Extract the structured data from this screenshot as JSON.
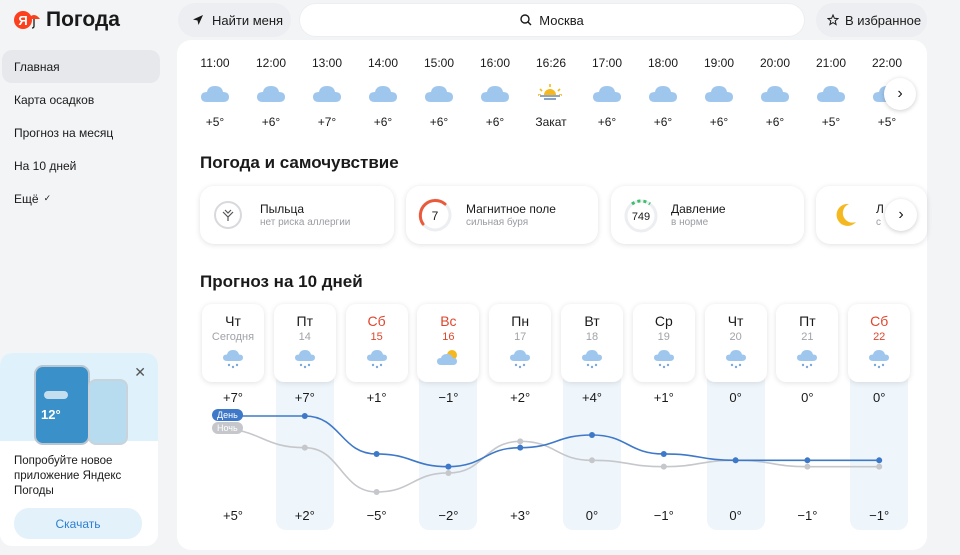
{
  "header": {
    "logo_mark": "Я",
    "app_title": "Погода",
    "find_me": "Найти меня",
    "search_value": "Москва",
    "favorites": "В избранное"
  },
  "sidebar": {
    "items": [
      {
        "label": "Главная",
        "active": true
      },
      {
        "label": "Карта осадков",
        "active": false
      },
      {
        "label": "Прогноз на месяц",
        "active": false
      },
      {
        "label": "На 10 дней",
        "active": false
      },
      {
        "label": "Ещё",
        "active": false
      }
    ]
  },
  "promo": {
    "phone_temp": "12°",
    "text": "Попробуйте новое приложение Яндекс Погоды",
    "button": "Скачать"
  },
  "hourly": [
    {
      "time": "11:00",
      "temp": "+5°",
      "icon": "cloud-icon"
    },
    {
      "time": "12:00",
      "temp": "+6°",
      "icon": "cloud-icon"
    },
    {
      "time": "13:00",
      "temp": "+7°",
      "icon": "cloud-icon"
    },
    {
      "time": "14:00",
      "temp": "+6°",
      "icon": "cloud-icon"
    },
    {
      "time": "15:00",
      "temp": "+6°",
      "icon": "cloud-icon"
    },
    {
      "time": "16:00",
      "temp": "+6°",
      "icon": "cloud-icon"
    },
    {
      "time": "16:26",
      "temp": "Закат",
      "icon": "sunset-icon"
    },
    {
      "time": "17:00",
      "temp": "+6°",
      "icon": "cloud-icon"
    },
    {
      "time": "18:00",
      "temp": "+6°",
      "icon": "cloud-icon"
    },
    {
      "time": "19:00",
      "temp": "+6°",
      "icon": "cloud-icon"
    },
    {
      "time": "20:00",
      "temp": "+6°",
      "icon": "cloud-icon"
    },
    {
      "time": "21:00",
      "temp": "+5°",
      "icon": "cloud-icon"
    },
    {
      "time": "22:00",
      "temp": "+5°",
      "icon": "cloud-icon"
    }
  ],
  "wellbeing": {
    "title": "Погода и самочувствие",
    "cards": [
      {
        "title": "Пыльца",
        "sub": "нет риска аллергии",
        "icon": "pollen-icon"
      },
      {
        "title": "Магнитное поле",
        "sub": "сильная буря",
        "value": "7",
        "icon": "magnetic-gauge-icon"
      },
      {
        "title": "Давление",
        "sub": "в норме",
        "value": "749",
        "icon": "pressure-gauge-icon"
      },
      {
        "title": "Л",
        "sub": "с",
        "icon": "moon-icon"
      }
    ]
  },
  "forecast": {
    "title": "Прогноз на 10 дней",
    "day_label": "День",
    "night_label": "Ночь",
    "days": [
      {
        "dow": "Чт",
        "date": "Сегодня",
        "weekend": false,
        "highlight": false,
        "icon": "snow-cloud-icon"
      },
      {
        "dow": "Пт",
        "date": "14",
        "weekend": false,
        "highlight": true,
        "icon": "snow-cloud-icon"
      },
      {
        "dow": "Сб",
        "date": "15",
        "weekend": true,
        "highlight": false,
        "icon": "snow-cloud-icon"
      },
      {
        "dow": "Вс",
        "date": "16",
        "weekend": true,
        "highlight": true,
        "icon": "partly-cloudy-icon"
      },
      {
        "dow": "Пн",
        "date": "17",
        "weekend": false,
        "highlight": false,
        "icon": "snow-cloud-icon"
      },
      {
        "dow": "Вт",
        "date": "18",
        "weekend": false,
        "highlight": true,
        "icon": "snow-cloud-icon"
      },
      {
        "dow": "Ср",
        "date": "19",
        "weekend": false,
        "highlight": false,
        "icon": "snow-cloud-icon"
      },
      {
        "dow": "Чт",
        "date": "20",
        "weekend": false,
        "highlight": true,
        "icon": "snow-cloud-icon"
      },
      {
        "dow": "Пт",
        "date": "21",
        "weekend": false,
        "highlight": false,
        "icon": "snow-cloud-icon"
      },
      {
        "dow": "Сб",
        "date": "22",
        "weekend": true,
        "highlight": true,
        "icon": "snow-cloud-icon"
      }
    ],
    "day_temps": [
      "+7°",
      "+7°",
      "+1°",
      "−1°",
      "+2°",
      "+4°",
      "+1°",
      "0°",
      "0°",
      "0°"
    ],
    "night_temps": [
      "+5°",
      "+2°",
      "−5°",
      "−2°",
      "+3°",
      "0°",
      "−1°",
      "0°",
      "−1°",
      "−1°"
    ],
    "day_values": [
      7,
      7,
      1,
      -1,
      2,
      4,
      1,
      0,
      0,
      0
    ],
    "night_values": [
      5,
      2,
      -5,
      -2,
      3,
      0,
      -1,
      0,
      -1,
      -1
    ]
  },
  "colors": {
    "brand": "#fc3f1d",
    "day_line": "#3e78c9",
    "night_line": "#c5c7cb",
    "weekend": "#e0462d",
    "highlight_col": "#eef5fb"
  }
}
